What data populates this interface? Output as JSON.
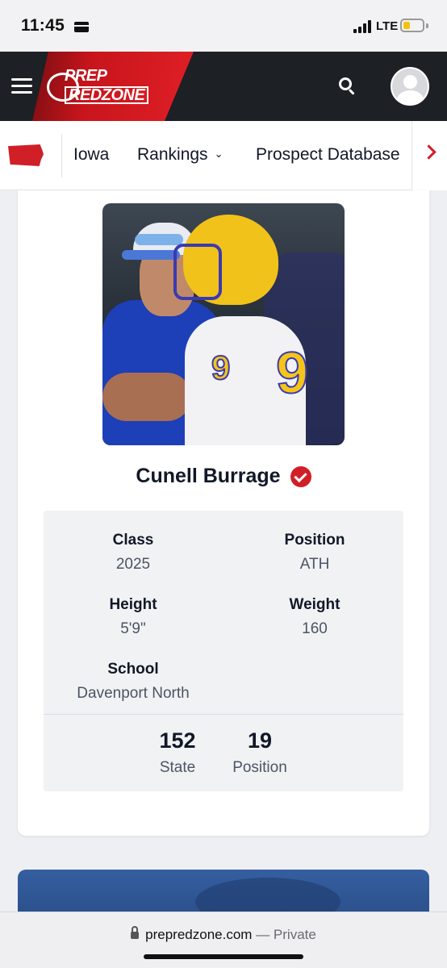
{
  "status_bar": {
    "time": "11:45",
    "network": "LTE",
    "battery_level": 0.25,
    "battery_color": "#f4c20d"
  },
  "header": {
    "logo_line1": "PREP",
    "logo_line2": "REDZONE",
    "menu_icon": "hamburger-icon",
    "search_icon": "search-icon",
    "avatar_icon": "user-avatar-icon",
    "brand_color": "#d11f27"
  },
  "nav": {
    "state_icon": "iowa-map-icon",
    "items": [
      {
        "label": "Iowa"
      },
      {
        "label": "Rankings"
      },
      {
        "label": "Prospect Database"
      }
    ],
    "scroll_icon": "chevron-right-icon"
  },
  "profile": {
    "name": "Cunell Burrage",
    "verified_icon": "verified-check-icon",
    "stats": {
      "class_label": "Class",
      "class_value": "2025",
      "position_label": "Position",
      "position_value": "ATH",
      "height_label": "Height",
      "height_value": "5'9\"",
      "weight_label": "Weight",
      "weight_value": "160",
      "school_label": "School",
      "school_value": "Davenport North"
    },
    "rankings": {
      "state_rank": "152",
      "state_label": "State",
      "position_rank": "19",
      "position_label": "Position"
    }
  },
  "browser": {
    "url": "prepredzone.com",
    "separator": " — ",
    "mode": "Private",
    "lock_icon": "lock-icon"
  }
}
